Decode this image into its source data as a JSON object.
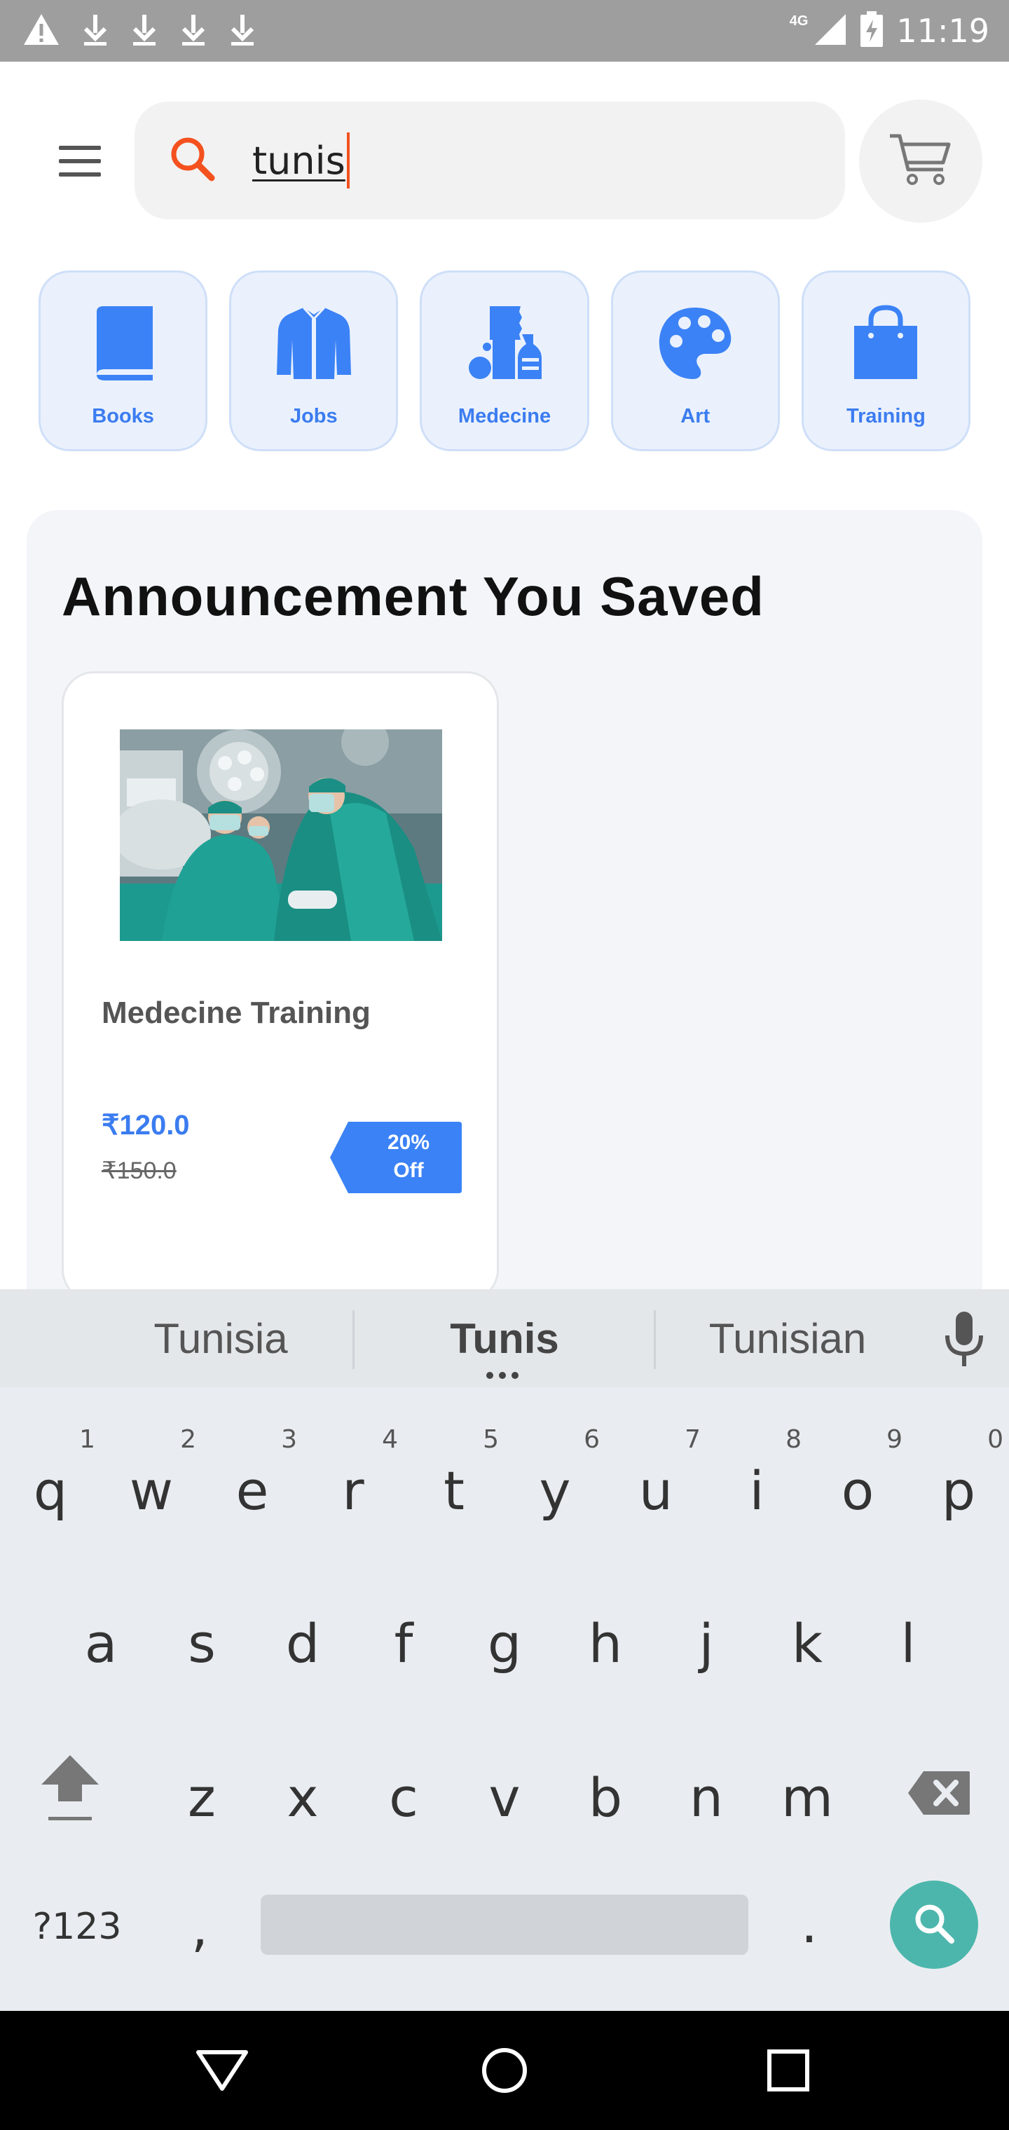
{
  "status_bar": {
    "time": "11:19",
    "network": "4G",
    "icons": [
      "warning-icon",
      "download-icon",
      "download-icon",
      "download-icon",
      "download-icon",
      "signal-icon",
      "battery-charging-icon"
    ]
  },
  "header": {
    "menu_icon": "hamburger-menu-icon",
    "search": {
      "value": "tunis",
      "icon": "search-icon"
    },
    "cart_icon": "cart-icon"
  },
  "categories": [
    {
      "label": "Books",
      "icon": "book-icon"
    },
    {
      "label": "Jobs",
      "icon": "jacket-icon"
    },
    {
      "label": "Medecine",
      "icon": "medicine-icon"
    },
    {
      "label": "Art",
      "icon": "palette-icon"
    },
    {
      "label": "Training",
      "icon": "shopping-bag-icon"
    }
  ],
  "saved_section": {
    "title": "Announcement You Saved",
    "cards": [
      {
        "title": "Medecine Training",
        "price": "₹120.0",
        "old_price": "₹150.0",
        "discount_line1": "20%",
        "discount_line2": "Off",
        "image": "surgeons-operating-room-photo"
      }
    ]
  },
  "keyboard": {
    "suggestions": [
      "Tunisia",
      "Tunis",
      "Tunisian"
    ],
    "row1": [
      "q",
      "w",
      "e",
      "r",
      "t",
      "y",
      "u",
      "i",
      "o",
      "p"
    ],
    "row1_numbers": [
      "1",
      "2",
      "3",
      "4",
      "5",
      "6",
      "7",
      "8",
      "9",
      "0"
    ],
    "row2": [
      "a",
      "s",
      "d",
      "f",
      "g",
      "h",
      "j",
      "k",
      "l"
    ],
    "row3": [
      "z",
      "x",
      "c",
      "v",
      "b",
      "n",
      "m"
    ],
    "symbols_key": "?123",
    "comma_key": ",",
    "period_key": "."
  },
  "colors": {
    "accent_blue": "#3b7cf0",
    "search_orange": "#f4511e",
    "keyboard_action_teal": "#4db6ac"
  }
}
